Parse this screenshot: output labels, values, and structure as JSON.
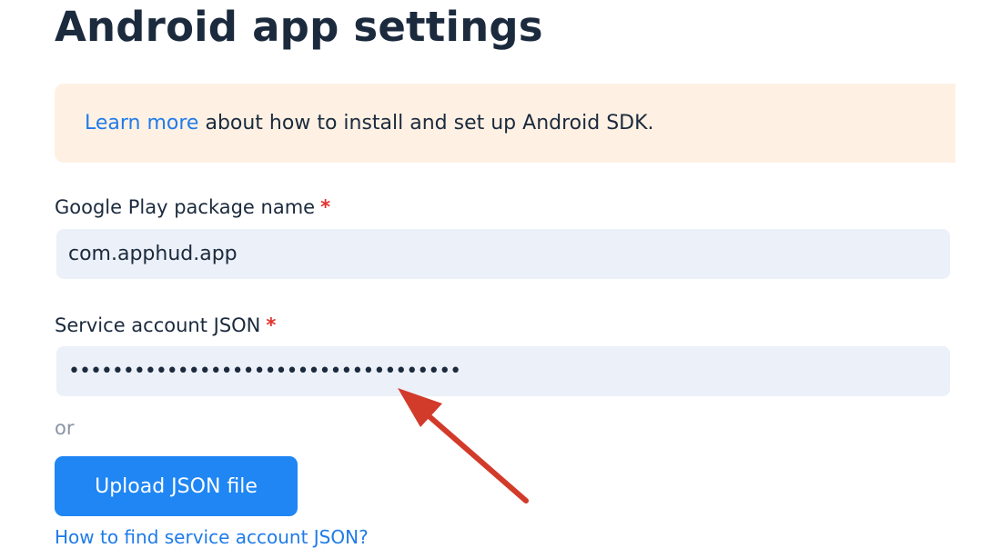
{
  "header": {
    "title": "Android app settings"
  },
  "banner": {
    "link_text": "Learn more",
    "text": " about how to install and set up Android SDK."
  },
  "package_field": {
    "label": "Google Play package name",
    "required_mark": "*",
    "value": "com.apphud.app"
  },
  "json_field": {
    "label": "Service account JSON",
    "required_mark": "*",
    "value": "••••••••••••••••••••••••••••••••••••"
  },
  "separator": {
    "or_text": "or"
  },
  "upload": {
    "button_label": "Upload JSON file"
  },
  "help": {
    "link_text": "How to find service account JSON?"
  },
  "colors": {
    "accent": "#1f86f4",
    "link": "#1f7be8",
    "banner_bg": "#fef1e4",
    "input_bg": "#ecf0f8",
    "required": "#e0332f",
    "annotation_arrow": "#d23a2a"
  },
  "icons": {
    "annotation": "red-arrow-icon"
  }
}
